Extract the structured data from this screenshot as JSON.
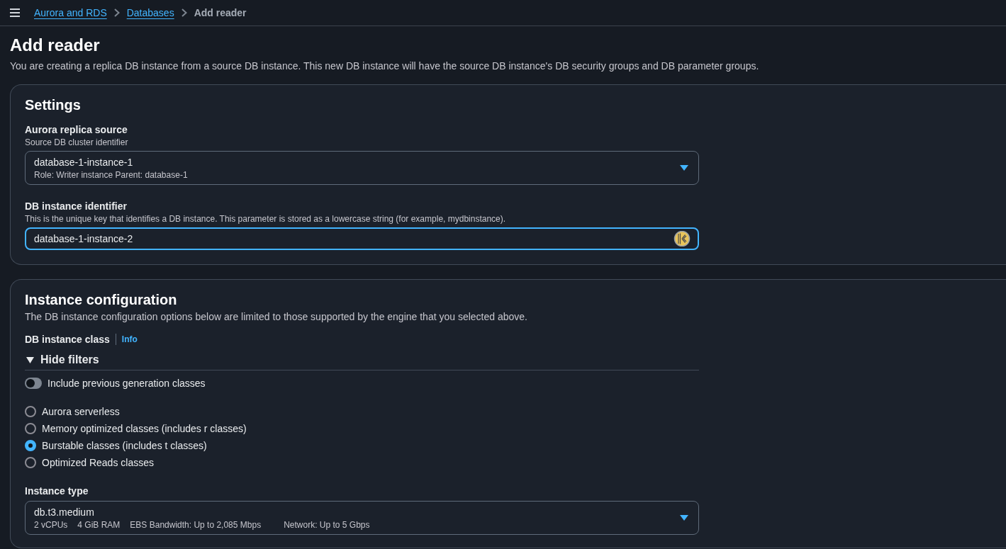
{
  "breadcrumbs": [
    {
      "label": "Aurora and RDS",
      "kind": "link"
    },
    {
      "label": "Databases",
      "kind": "link"
    },
    {
      "label": "Add reader",
      "kind": "current"
    }
  ],
  "header": {
    "title": "Add reader",
    "description": "You are creating a replica DB instance from a source DB instance. This new DB instance will have the source DB instance's DB security groups and DB parameter groups."
  },
  "settings": {
    "title": "Settings",
    "fields": [
      {
        "kind": "select",
        "label": "Aurora replica source",
        "description": "Source DB cluster identifier",
        "value": "database-1-instance-1",
        "details": [
          "Role: Writer instance Parent: database-1"
        ]
      },
      {
        "kind": "input",
        "label": "DB instance identifier",
        "description": "This is the unique key that identifies a DB instance. This parameter is stored as a lowercase string (for example, mydbinstance).",
        "value": "database-1-instance-2",
        "focused": true
      }
    ]
  },
  "instance_configuration": {
    "title": "Instance configuration",
    "description": "The DB instance configuration options below are limited to those supported by the engine that you selected above.",
    "class_label": "DB instance class",
    "info_link": "Info",
    "filters": {
      "label": "Hide filters",
      "expanded": true,
      "toggle": {
        "label": "Include previous generation classes",
        "on": false
      }
    },
    "classes": [
      {
        "label": "Aurora serverless",
        "selected": false
      },
      {
        "label": "Memory optimized classes (includes r classes)",
        "selected": false
      },
      {
        "label": "Burstable classes (includes t classes)",
        "selected": true
      },
      {
        "label": "Optimized Reads classes",
        "selected": false
      }
    ],
    "instance_type": {
      "label": "Instance type",
      "value": "db.t3.medium",
      "details": [
        "2 vCPUs",
        "4 GiB RAM",
        "EBS Bandwidth: Up to 2,085 Mbps",
        "Network: Up to 5 Gbps"
      ]
    }
  }
}
